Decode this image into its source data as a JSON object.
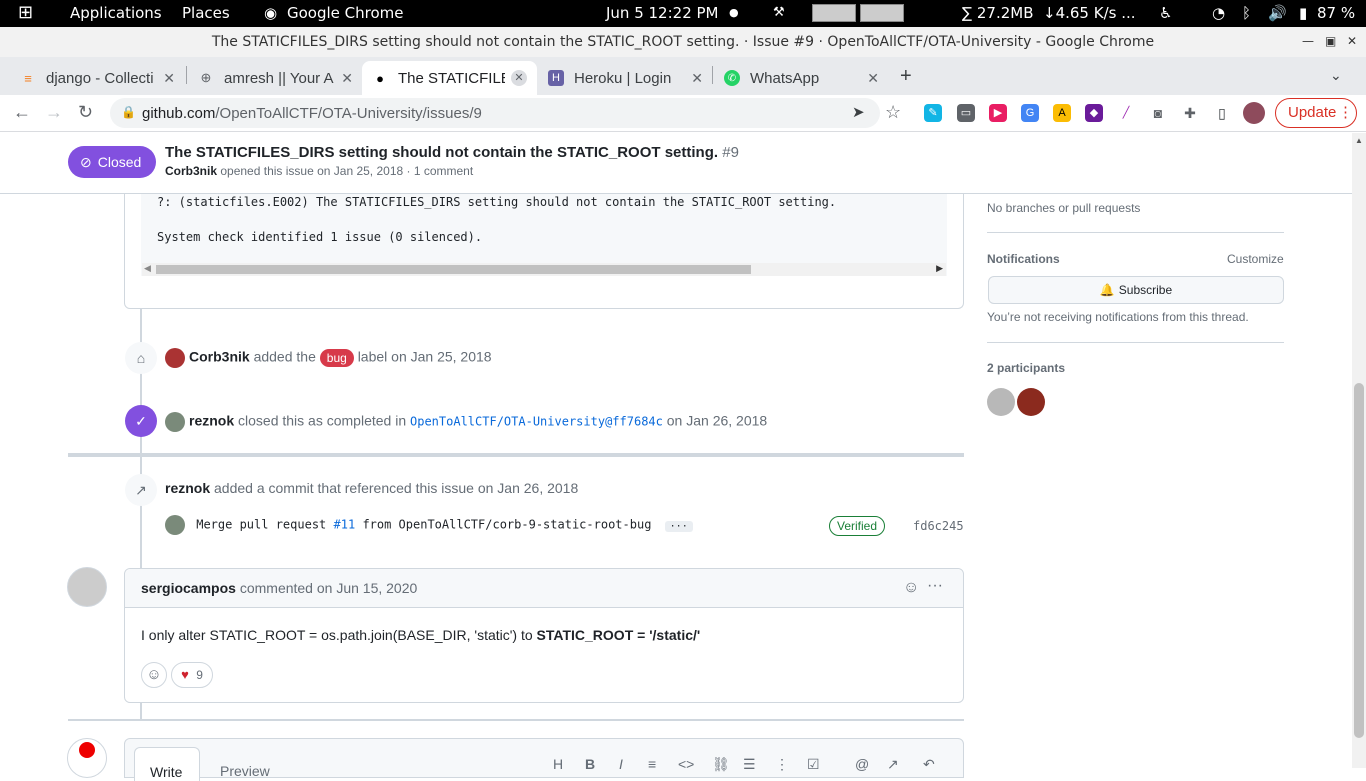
{
  "os_bar": {
    "apps": "Applications",
    "places": "Places",
    "active_app": "Google Chrome",
    "datetime": "Jun 5  12:22 PM",
    "memory": "∑ 27.2MB",
    "network": "↓4.65 K/s ...",
    "battery": "87 %"
  },
  "window": {
    "title": "The STATICFILES_DIRS setting should not contain the STATIC_ROOT setting. · Issue #9 · OpenToAllCTF/OTA-University - Google Chrome"
  },
  "tabs": [
    {
      "title": "django - Collecti",
      "icon": "stackoverflow-icon"
    },
    {
      "title": "amresh || Your A",
      "icon": "globe-icon"
    },
    {
      "title": "The STATICFILE",
      "icon": "github-icon"
    },
    {
      "title": "Heroku | Login",
      "icon": "heroku-icon"
    },
    {
      "title": "WhatsApp",
      "icon": "whatsapp-icon"
    }
  ],
  "address": {
    "host": "github.com",
    "path": "/OpenToAllCTF/OTA-University/issues/9",
    "update_label": "Update"
  },
  "issue": {
    "state": "Closed",
    "title": "The STATICFILES_DIRS setting should not contain the STATIC_ROOT setting.",
    "number": "#9",
    "author": "Corb3nik",
    "opened_text": "opened this issue on Jan 25, 2018 · 1 comment"
  },
  "code": {
    "line1": "?: (staticfiles.E002) The STATICFILES_DIRS setting should not contain the STATIC_ROOT setting.",
    "line2": "System check identified 1 issue (0 silenced)."
  },
  "timeline": {
    "label_event": {
      "user": "Corb3nik",
      "pre": "added the",
      "label": "bug",
      "post": "label on Jan 25, 2018"
    },
    "closed_event": {
      "user": "reznok",
      "pre": "closed this as completed in",
      "ref": "OpenToAllCTF/OTA-University@ff7684c",
      "post": "on Jan 26, 2018"
    },
    "commit_event": {
      "user": "reznok",
      "text": "added a commit that referenced this issue on Jan 26, 2018"
    },
    "commit": {
      "msg_pre": "Merge pull request",
      "pr": "#11",
      "msg_post": "from OpenToAllCTF/corb-9-static-root-bug",
      "more": "···",
      "verified": "Verified",
      "sha": "fd6c245"
    }
  },
  "comment": {
    "author": "sergiocampos",
    "when": "commented on Jun 15, 2020",
    "body_plain": "I only alter STATIC_ROOT = os.path.join(BASE_DIR, 'static') to",
    "body_bold": "STATIC_ROOT = '/static/'",
    "heart_count": "9"
  },
  "sidebar": {
    "development_empty": "No branches or pull requests",
    "notifications_heading": "Notifications",
    "customize": "Customize",
    "subscribe": "Subscribe",
    "notif_note": "You’re not receiving notifications from this thread.",
    "participants_heading": "2 participants"
  },
  "editor": {
    "write": "Write",
    "preview": "Preview"
  },
  "colors": {
    "closed": "#8250df",
    "bug": "#d73a4a",
    "verified": "#1a7f37",
    "link": "#0969da"
  }
}
